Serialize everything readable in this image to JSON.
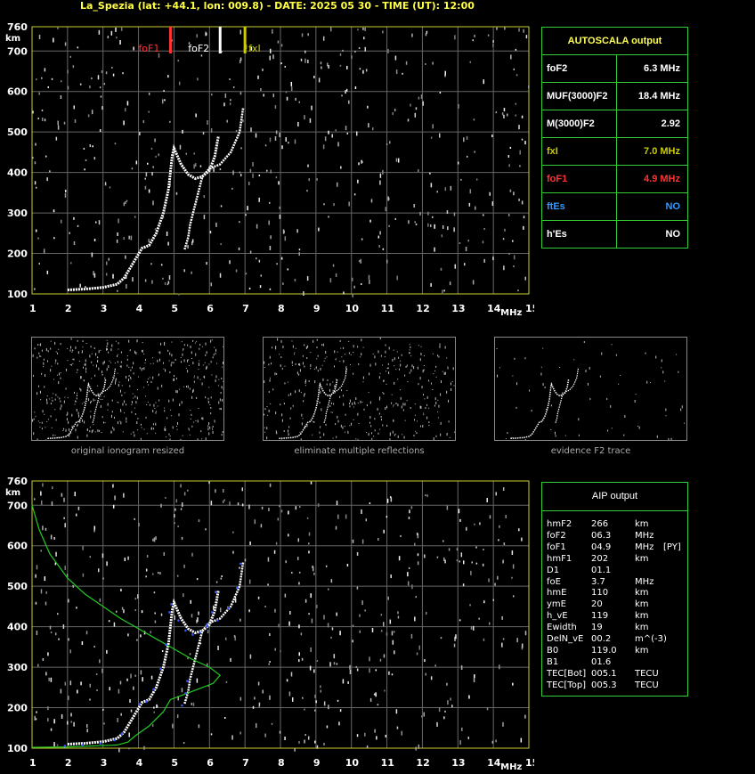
{
  "header": {
    "title": "La_Spezia (lat: +44.1, lon: 009.8) - DATE: 2025 05 30 - TIME (UT): 12:00"
  },
  "axes": {
    "y_ticks": [
      "760",
      "700",
      "600",
      "500",
      "400",
      "300",
      "200",
      "100"
    ],
    "y_unit": "km",
    "x_ticks": [
      "1",
      "2",
      "3",
      "4",
      "5",
      "6",
      "7",
      "8",
      "9",
      "10",
      "11",
      "12",
      "13",
      "14",
      "15"
    ],
    "x_unit": "MHz"
  },
  "markers": {
    "foF1": "foF1",
    "foF2": "foF2",
    "fxI": "fxI"
  },
  "autoscala": {
    "title": "AUTOSCALA output",
    "rows": [
      {
        "key": "foF2",
        "value": "6.3 MHz",
        "color": "#ffffff"
      },
      {
        "key": "MUF(3000)F2",
        "value": "18.4 MHz",
        "color": "#ffffff"
      },
      {
        "key": "M(3000)F2",
        "value": "2.92",
        "color": "#ffffff"
      },
      {
        "key": "fxI",
        "value": "7.0 MHz",
        "color": "#cccc00"
      },
      {
        "key": "foF1",
        "value": "4.9 MHz",
        "color": "#ff3333"
      },
      {
        "key": "ftEs",
        "value": "NO",
        "color": "#3399ff"
      },
      {
        "key": "h'Es",
        "value": "NO",
        "color": "#ffffff"
      }
    ]
  },
  "thumbnails": [
    {
      "caption": "original ionogram resized"
    },
    {
      "caption": "eliminate multiple reflections"
    },
    {
      "caption": "evidence F2 trace"
    }
  ],
  "aip": {
    "title": "AIP output",
    "rows": [
      [
        "hmF2",
        "266",
        "km",
        ""
      ],
      [
        "foF2",
        "06.3",
        "MHz",
        ""
      ],
      [
        "foF1",
        "04.9",
        "MHz",
        "[PY]"
      ],
      [
        "hmF1",
        "202",
        "km",
        ""
      ],
      [
        "D1",
        "01.1",
        "",
        ""
      ],
      [
        "foE",
        "3.7",
        "MHz",
        ""
      ],
      [
        "hmE",
        "110",
        "km",
        ""
      ],
      [
        "ymE",
        "20",
        "km",
        ""
      ],
      [
        "h_vE",
        "119",
        "km",
        ""
      ],
      [
        "Ewidth",
        "19",
        "km",
        ""
      ],
      [
        "DelN_vE",
        "00.2",
        "m^(-3)",
        ""
      ],
      [
        "B0",
        "119.0",
        "km",
        ""
      ],
      [
        "B1",
        "01.6",
        "",
        ""
      ],
      [
        "TEC[Bot]",
        "005.1",
        "TECU",
        ""
      ],
      [
        "TEC[Top]",
        "005.3",
        "TECU",
        ""
      ]
    ]
  },
  "chart_data": {
    "type": "scatter",
    "xlim": [
      1,
      15
    ],
    "ylim": [
      100,
      760
    ],
    "grid": true,
    "series": [
      {
        "name": "foF1",
        "values": [
          {
            "x": 4.9,
            "y": 760
          }
        ],
        "color": "#ff3333"
      },
      {
        "name": "foF2",
        "values": [
          {
            "x": 6.3,
            "y": 760
          }
        ],
        "color": "#ffffff"
      },
      {
        "name": "fxI",
        "values": [
          {
            "x": 7.0,
            "y": 760
          }
        ],
        "color": "#cccc00"
      }
    ],
    "o_trace": [
      {
        "x": 2.0,
        "y": 110
      },
      {
        "x": 2.5,
        "y": 112
      },
      {
        "x": 3.0,
        "y": 116
      },
      {
        "x": 3.4,
        "y": 124
      },
      {
        "x": 3.6,
        "y": 140
      },
      {
        "x": 4.1,
        "y": 213
      },
      {
        "x": 4.3,
        "y": 220
      },
      {
        "x": 4.5,
        "y": 250
      },
      {
        "x": 4.7,
        "y": 300
      },
      {
        "x": 4.85,
        "y": 360
      },
      {
        "x": 4.95,
        "y": 440
      },
      {
        "x": 5.0,
        "y": 460
      },
      {
        "x": 5.2,
        "y": 420
      },
      {
        "x": 5.4,
        "y": 395
      },
      {
        "x": 5.6,
        "y": 385
      },
      {
        "x": 5.8,
        "y": 390
      },
      {
        "x": 6.0,
        "y": 405
      },
      {
        "x": 6.15,
        "y": 440
      },
      {
        "x": 6.25,
        "y": 490
      }
    ],
    "x_trace": [
      {
        "x": 5.3,
        "y": 210
      },
      {
        "x": 5.4,
        "y": 240
      },
      {
        "x": 5.45,
        "y": 270
      },
      {
        "x": 5.8,
        "y": 390
      },
      {
        "x": 6.0,
        "y": 410
      },
      {
        "x": 6.3,
        "y": 420
      },
      {
        "x": 6.6,
        "y": 450
      },
      {
        "x": 6.85,
        "y": 500
      },
      {
        "x": 6.95,
        "y": 560
      }
    ],
    "profile": [
      {
        "x": 1.0,
        "y": 700
      },
      {
        "x": 1.2,
        "y": 640
      },
      {
        "x": 1.5,
        "y": 580
      },
      {
        "x": 2.0,
        "y": 520
      },
      {
        "x": 2.5,
        "y": 480
      },
      {
        "x": 3.0,
        "y": 450
      },
      {
        "x": 3.5,
        "y": 420
      },
      {
        "x": 4.0,
        "y": 395
      },
      {
        "x": 4.5,
        "y": 370
      },
      {
        "x": 5.0,
        "y": 345
      },
      {
        "x": 5.5,
        "y": 320
      },
      {
        "x": 6.0,
        "y": 300
      },
      {
        "x": 6.3,
        "y": 280
      },
      {
        "x": 6.1,
        "y": 260
      },
      {
        "x": 5.5,
        "y": 240
      },
      {
        "x": 4.9,
        "y": 220
      },
      {
        "x": 4.7,
        "y": 190
      },
      {
        "x": 4.3,
        "y": 155
      },
      {
        "x": 3.9,
        "y": 130
      },
      {
        "x": 3.7,
        "y": 115
      },
      {
        "x": 3.4,
        "y": 108
      },
      {
        "x": 2.0,
        "y": 103
      },
      {
        "x": 1.0,
        "y": 102
      }
    ]
  }
}
